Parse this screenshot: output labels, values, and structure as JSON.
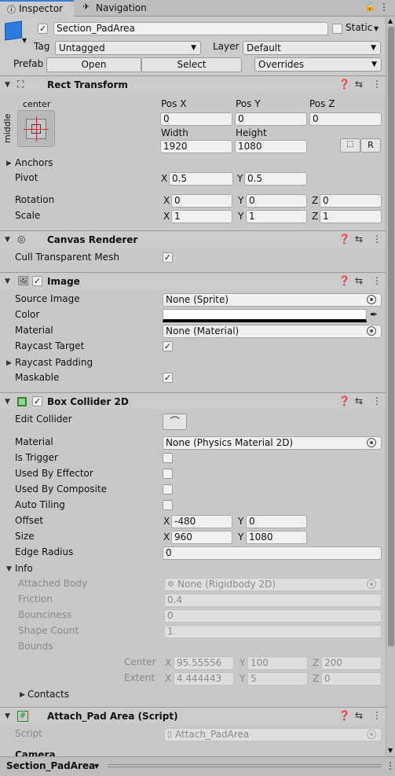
{
  "tabs": {
    "inspector": "Inspector",
    "navigation": "Navigation"
  },
  "header": {
    "object_name": "Section_PadArea",
    "static_label": "Static",
    "tag_label": "Tag",
    "tag_value": "Untagged",
    "layer_label": "Layer",
    "layer_value": "Default",
    "prefab_label": "Prefab",
    "open": "Open",
    "select": "Select",
    "overrides": "Overrides"
  },
  "rect_transform": {
    "title": "Rect Transform",
    "anchor_h": "center",
    "anchor_v": "middle",
    "pos_x_label": "Pos X",
    "pos_y_label": "Pos Y",
    "pos_z_label": "Pos Z",
    "pos_x": "0",
    "pos_y": "0",
    "pos_z": "0",
    "width_label": "Width",
    "height_label": "Height",
    "width": "1920",
    "height": "1080",
    "r_button": "R",
    "anchors": "Anchors",
    "pivot": "Pivot",
    "pivot_x": "0.5",
    "pivot_y": "0.5",
    "rotation": "Rotation",
    "rot_x": "0",
    "rot_y": "0",
    "rot_z": "0",
    "scale": "Scale",
    "scale_x": "1",
    "scale_y": "1",
    "scale_z": "1",
    "x": "X",
    "y": "Y",
    "z": "Z"
  },
  "canvas_renderer": {
    "title": "Canvas Renderer",
    "cull": "Cull Transparent Mesh"
  },
  "image": {
    "title": "Image",
    "source_image": "Source Image",
    "source_image_value": "None (Sprite)",
    "color": "Color",
    "color_value": "#ffffff",
    "material": "Material",
    "material_value": "None (Material)",
    "raycast_target": "Raycast Target",
    "raycast_padding": "Raycast Padding",
    "maskable": "Maskable"
  },
  "box_collider": {
    "title": "Box Collider 2D",
    "edit_collider": "Edit Collider",
    "material": "Material",
    "material_value": "None (Physics Material 2D)",
    "is_trigger": "Is Trigger",
    "used_by_effector": "Used By Effector",
    "used_by_composite": "Used By Composite",
    "auto_tiling": "Auto Tiling",
    "offset": "Offset",
    "offset_x": "-480",
    "offset_y": "0",
    "size": "Size",
    "size_x": "960",
    "size_y": "1080",
    "edge_radius": "Edge Radius",
    "edge_radius_value": "0",
    "info": "Info",
    "attached_body": "Attached Body",
    "attached_body_value": "None (Rigidbody 2D)",
    "friction": "Friction",
    "friction_value": "0.4",
    "bounciness": "Bounciness",
    "bounciness_value": "0",
    "shape_count": "Shape Count",
    "shape_count_value": "1",
    "bounds": "Bounds",
    "center": "Center",
    "center_x": "95.55556",
    "center_y": "100",
    "center_z": "200",
    "extent": "Extent",
    "extent_x": "4.444443",
    "extent_y": "5",
    "extent_z": "0",
    "contacts": "Contacts"
  },
  "script": {
    "title": "Attach_Pad Area (Script)",
    "script_label": "Script",
    "script_value": "Attach_PadArea",
    "camera": "Camera"
  },
  "footer": {
    "object": "Section_PadArea"
  }
}
